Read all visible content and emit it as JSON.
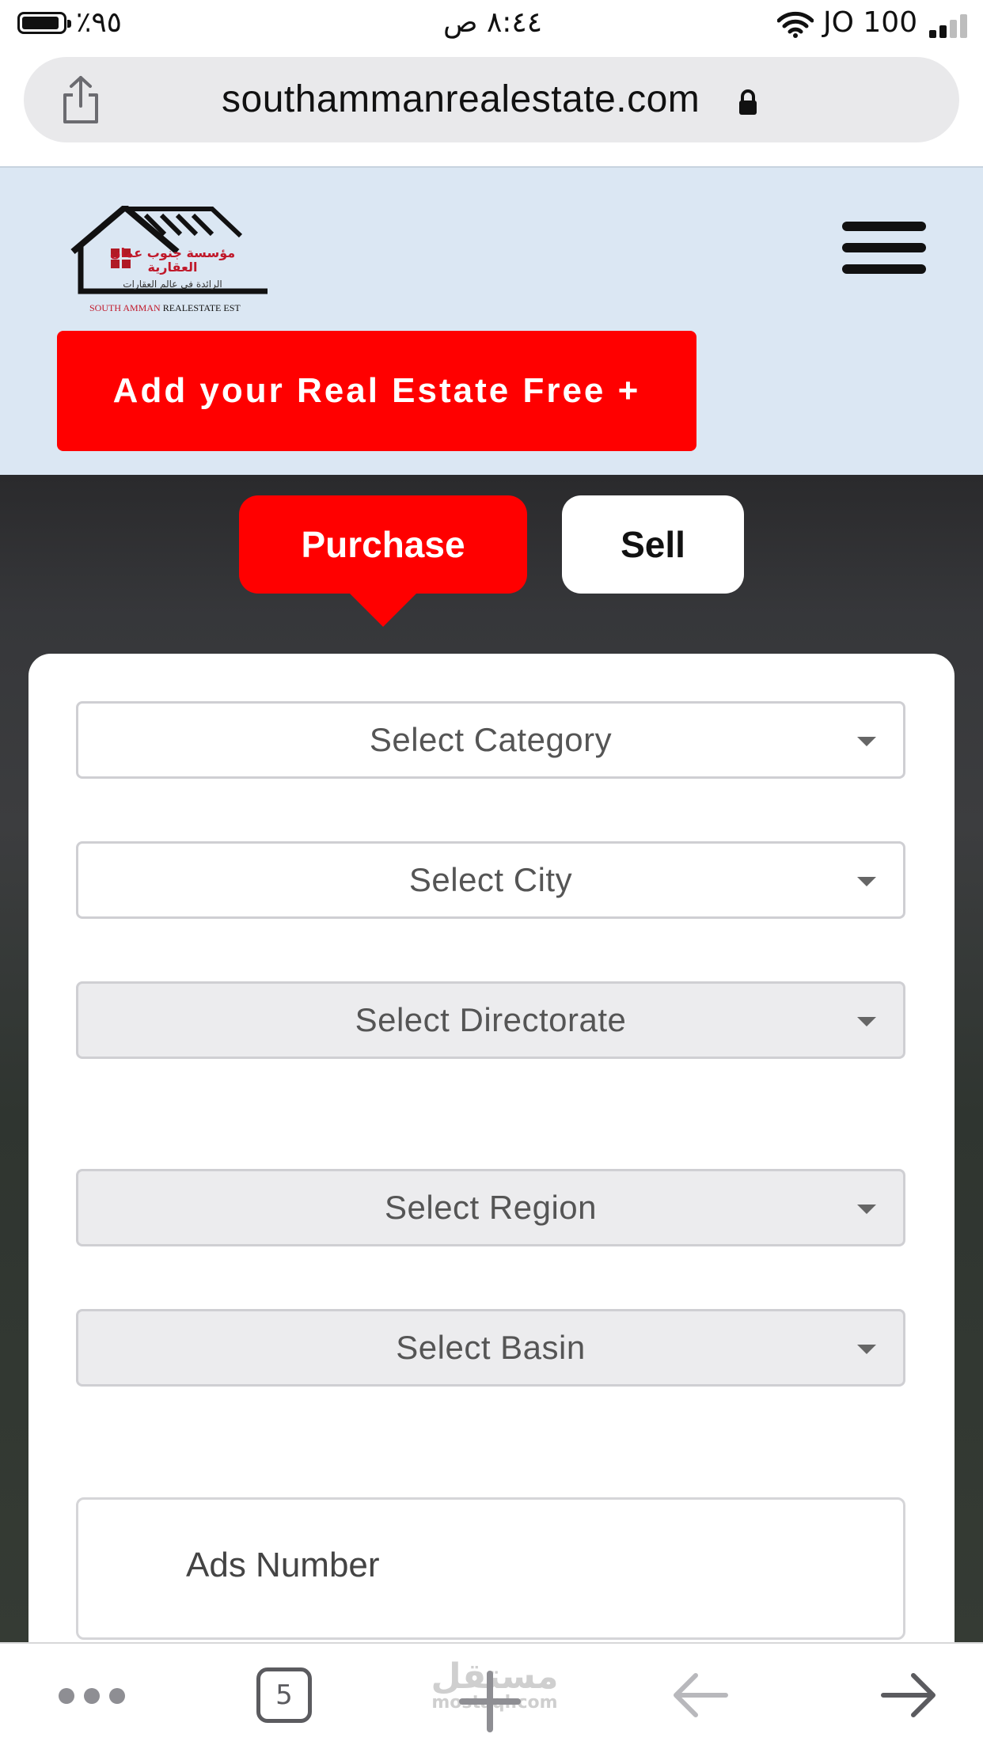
{
  "status_bar": {
    "battery": "٪٩٥",
    "time": "٨:٤٤ ص",
    "carrier": "JO 100"
  },
  "browser": {
    "url": "southammanrealestate.com"
  },
  "header": {
    "logo": {
      "arabic_name_line1": "مؤسسة جنوب عمان",
      "arabic_name_line2": "العقارية",
      "arabic_tagline": "الرائدة في عالم العقارات",
      "english_name_red": "SOUTH AMMAN",
      "english_name_black": "REALESTATE EST"
    },
    "add_button_label": "Add your Real Estate Free +"
  },
  "tabs": {
    "purchase_label": "Purchase",
    "sell_label": "Sell",
    "active": "Purchase"
  },
  "form": {
    "category_placeholder": "Select Category",
    "city_placeholder": "Select City",
    "directorate_placeholder": "Select Directorate",
    "region_placeholder": "Select Region",
    "basin_placeholder": "Select Basin",
    "ads_number_placeholder": "Ads Number"
  },
  "toolbar": {
    "tab_count": "5",
    "watermark_ar": "مستقل",
    "watermark_en": "mostaql.com"
  },
  "colors": {
    "accent": "#ff0000",
    "header_bg": "#dbe7f3",
    "hero_bg": "#2e2f31"
  },
  "icons": [
    "share-icon",
    "lock-icon",
    "hamburger-menu-icon",
    "more-dots-icon",
    "tabs-icon",
    "new-tab-plus-icon",
    "back-arrow-icon",
    "forward-arrow-icon",
    "wifi-icon",
    "signal-icon",
    "battery-icon"
  ]
}
